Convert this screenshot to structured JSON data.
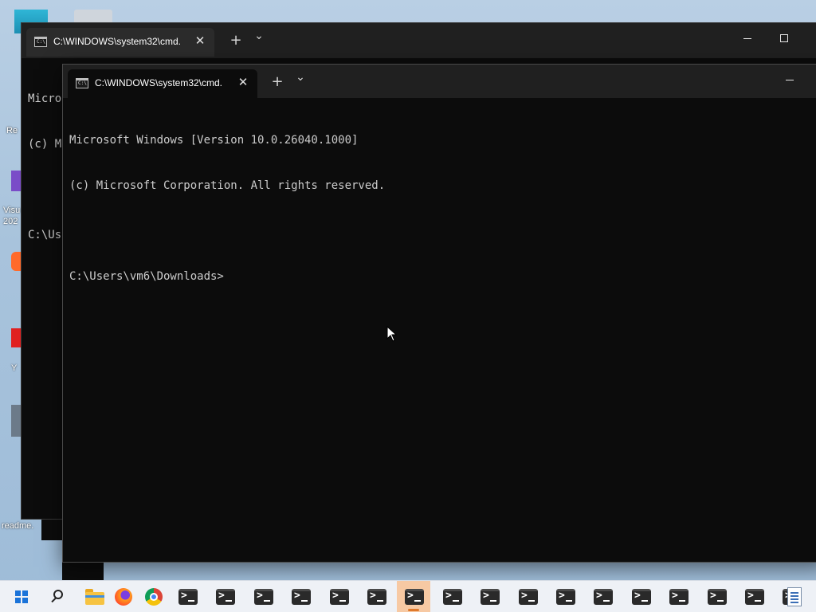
{
  "desktop": {
    "icons": [
      {
        "name": "recycle-bin-icon",
        "label": "Re"
      },
      {
        "name": "visual-studio-icon",
        "label": "Visu"
      },
      {
        "name": "visual-studio-icon-year",
        "label": "202"
      },
      {
        "name": "firefox-shortcut-icon",
        "label": "Y"
      },
      {
        "name": "readme-file-icon",
        "label": "readme."
      }
    ]
  },
  "back_window": {
    "tab_title": "C:\\WINDOWS\\system32\\cmd.",
    "console_lines": [
      "Micro",
      "(c) M",
      "",
      "C:\\Us"
    ]
  },
  "front_window": {
    "tab_title": "C:\\WINDOWS\\system32\\cmd.",
    "console_lines": [
      "Microsoft Windows [Version 10.0.26040.1000]",
      "(c) Microsoft Corporation. All rights reserved.",
      "",
      "C:\\Users\\vm6\\Downloads>"
    ]
  },
  "tab_controls": {
    "close_glyph": "✕",
    "new_tab_glyph": "+",
    "dropdown_glyph": "⌄"
  },
  "taskbar": {
    "pinned": [
      "start-button",
      "search",
      "file-explorer",
      "firefox",
      "chrome"
    ],
    "terminal_count": 17,
    "active_terminal_index": 6
  }
}
